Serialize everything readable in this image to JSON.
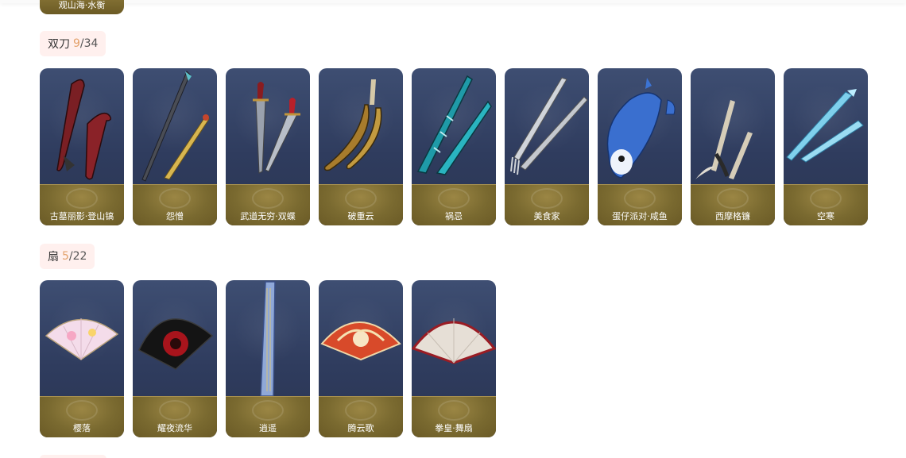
{
  "prev_item": {
    "label": "观山海·水衡"
  },
  "sections": [
    {
      "name": "双刀",
      "got": "9",
      "sep": "/",
      "total": "34",
      "items": [
        {
          "label": "古墓丽影·登山镐",
          "icon": "red-ice-axes-icon"
        },
        {
          "label": "怨憎",
          "icon": "dark-gold-blades-icon"
        },
        {
          "label": "武道无穷·双蝶",
          "icon": "butterfly-swords-icon"
        },
        {
          "label": "破重云",
          "icon": "golden-curved-blades-icon"
        },
        {
          "label": "祸忌",
          "icon": "teal-jagged-blades-icon"
        },
        {
          "label": "美食家",
          "icon": "knife-fork-icon"
        },
        {
          "label": "蛋仔派对·咸鱼",
          "icon": "blue-fish-icon"
        },
        {
          "label": "西摩格镰",
          "icon": "dark-sickles-icon"
        },
        {
          "label": "空寒",
          "icon": "ice-blades-icon"
        }
      ]
    },
    {
      "name": "扇",
      "got": "5",
      "sep": "/",
      "total": "22",
      "items": [
        {
          "label": "樱落",
          "icon": "sakura-fan-icon"
        },
        {
          "label": "耀夜流华",
          "icon": "black-red-fan-icon"
        },
        {
          "label": "逍遥",
          "icon": "closed-blue-fan-icon"
        },
        {
          "label": "腾云歌",
          "icon": "phoenix-fan-icon"
        },
        {
          "label": "拳皇·舞扇",
          "icon": "white-red-fan-icon"
        }
      ]
    }
  ]
}
